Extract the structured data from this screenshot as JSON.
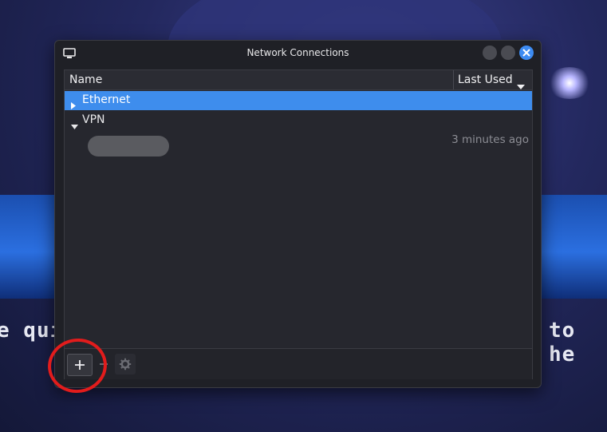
{
  "window": {
    "title": "Network Connections",
    "accent_color": "#3e8ded"
  },
  "columns": {
    "name": "Name",
    "last_used": "Last Used"
  },
  "connections": [
    {
      "label": "Ethernet",
      "expanded": false,
      "selected": true
    },
    {
      "label": "VPN",
      "expanded": true,
      "selected": false,
      "children": [
        {
          "label": "",
          "last_used": "3 minutes ago"
        }
      ]
    }
  ],
  "toolbar": {
    "add": "plus-icon",
    "remove": "minus-icon",
    "settings": "gear-icon"
  },
  "wallpaper_text": {
    "left": "e qui",
    "right": "to he"
  },
  "annotation": {
    "color": "#e21c1c"
  }
}
